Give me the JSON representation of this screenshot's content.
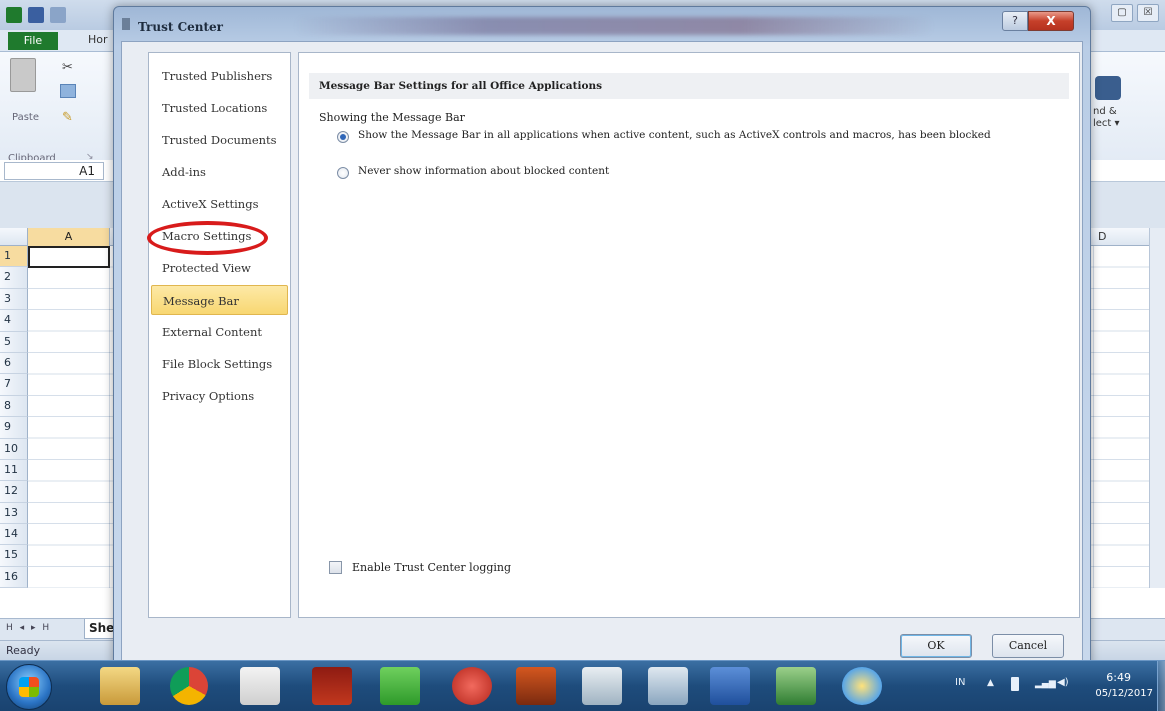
{
  "excel": {
    "file_tab": "File",
    "home_tab": "Hor",
    "paste_label": "Paste",
    "clipboard_label": "Clipboard",
    "find_label_line1": "nd &",
    "find_label_line2": "lect ▾",
    "name_box": "A1",
    "column_a": "A",
    "column_d": "D",
    "rows": [
      "1",
      "2",
      "3",
      "4",
      "5",
      "6",
      "7",
      "8",
      "9",
      "10",
      "11",
      "12",
      "13",
      "14",
      "15",
      "16"
    ],
    "sheet_tab": "She",
    "status": "Ready",
    "sheet_nav": "H ◂ ▸ H",
    "window_close": "☒",
    "window_min": "▢"
  },
  "dialog": {
    "title": "Trust Center",
    "help_button": "?",
    "close_button": "X",
    "nav_items": [
      {
        "label": "Trusted Publishers"
      },
      {
        "label": "Trusted Locations"
      },
      {
        "label": "Trusted Documents"
      },
      {
        "label": "Add-ins"
      },
      {
        "label": "ActiveX Settings"
      },
      {
        "label": "Macro Settings"
      },
      {
        "label": "Protected View"
      },
      {
        "label": "Message Bar"
      },
      {
        "label": "External Content"
      },
      {
        "label": "File Block Settings"
      },
      {
        "label": "Privacy Options"
      }
    ],
    "selected_nav": "Message Bar",
    "section_header": "Message Bar Settings for all Office Applications",
    "group_label": "Showing the Message Bar",
    "radio_show": "Show the Message Bar in all applications when active content, such as ActiveX controls and macros, has been blocked",
    "radio_never": "Never show information about blocked content",
    "radio_show_checked": true,
    "logging_checkbox_label": "Enable Trust Center logging",
    "logging_checked": false,
    "ok_label": "OK",
    "cancel_label": "Cancel",
    "highlight_color": "#d81b1b",
    "selected_color": "#f8d772"
  },
  "taskbar": {
    "icons": [
      "start-orb",
      "file-explorer",
      "chrome",
      "calendar",
      "book",
      "shield",
      "green-app",
      "speed-app",
      "media-app",
      "maps-app",
      "pen-app",
      "word",
      "excel",
      "paint"
    ],
    "language": "IN",
    "time": "6:49",
    "date": "05/12/2017"
  }
}
